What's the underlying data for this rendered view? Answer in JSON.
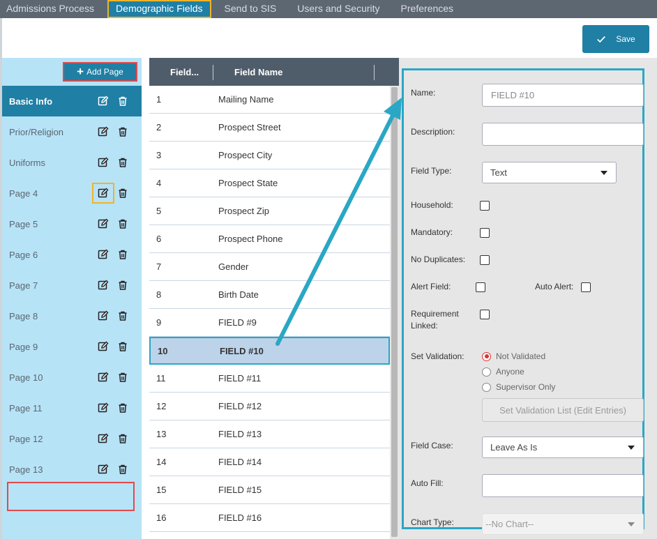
{
  "nav": {
    "tabs": [
      {
        "label": "Admissions Process"
      },
      {
        "label": "Demographic Fields"
      },
      {
        "label": "Send to SIS"
      },
      {
        "label": "Users and Security"
      },
      {
        "label": "Preferences"
      }
    ],
    "active_index": 1
  },
  "toolbar": {
    "save_label": "Save"
  },
  "pages": {
    "add_label": "Add Page",
    "items": [
      {
        "label": "Basic Info"
      },
      {
        "label": "Prior/Religion"
      },
      {
        "label": "Uniforms"
      },
      {
        "label": "Page 4"
      },
      {
        "label": "Page 5"
      },
      {
        "label": "Page 6"
      },
      {
        "label": "Page 7"
      },
      {
        "label": "Page 8"
      },
      {
        "label": "Page 9"
      },
      {
        "label": "Page 10"
      },
      {
        "label": "Page 11"
      },
      {
        "label": "Page 12"
      },
      {
        "label": "Page 13"
      }
    ]
  },
  "fields": {
    "col_num": "Field...",
    "col_name": "Field Name",
    "rows": [
      {
        "num": "1",
        "name": "Mailing Name"
      },
      {
        "num": "2",
        "name": "Prospect Street"
      },
      {
        "num": "3",
        "name": "Prospect City"
      },
      {
        "num": "4",
        "name": "Prospect State"
      },
      {
        "num": "5",
        "name": "Prospect Zip"
      },
      {
        "num": "6",
        "name": "Prospect Phone"
      },
      {
        "num": "7",
        "name": "Gender"
      },
      {
        "num": "8",
        "name": "Birth Date"
      },
      {
        "num": "9",
        "name": "FIELD #9"
      },
      {
        "num": "10",
        "name": "FIELD #10"
      },
      {
        "num": "11",
        "name": "FIELD #11"
      },
      {
        "num": "12",
        "name": "FIELD #12"
      },
      {
        "num": "13",
        "name": "FIELD #13"
      },
      {
        "num": "14",
        "name": "FIELD #14"
      },
      {
        "num": "15",
        "name": "FIELD #15"
      },
      {
        "num": "16",
        "name": "FIELD #16"
      }
    ]
  },
  "detail": {
    "name_label": "Name:",
    "name_value": "FIELD #10",
    "description_label": "Description:",
    "description_value": "",
    "field_type_label": "Field Type:",
    "field_type_value": "Text",
    "household_label": "Household:",
    "mandatory_label": "Mandatory:",
    "no_duplicates_label": "No Duplicates:",
    "alert_field_label": "Alert Field:",
    "auto_alert_label": "Auto Alert:",
    "requirement_linked_label_1": "Requirement",
    "requirement_linked_label_2": "Linked:",
    "set_validation_label": "Set Validation:",
    "validation_options": [
      "Not Validated",
      "Anyone",
      "Supervisor Only"
    ],
    "validation_list_button": "Set Validation List (Edit Entries)",
    "field_case_label": "Field Case:",
    "field_case_value": "Leave As Is",
    "auto_fill_label": "Auto Fill:",
    "auto_fill_value": "",
    "chart_type_label": "Chart Type:",
    "chart_type_value": "--No Chart--"
  },
  "colors": {
    "accent": "#1f7fa5",
    "highlight_cyan": "#2aa7c4",
    "highlight_orange": "#f0b429",
    "highlight_red": "#e14a4a"
  }
}
